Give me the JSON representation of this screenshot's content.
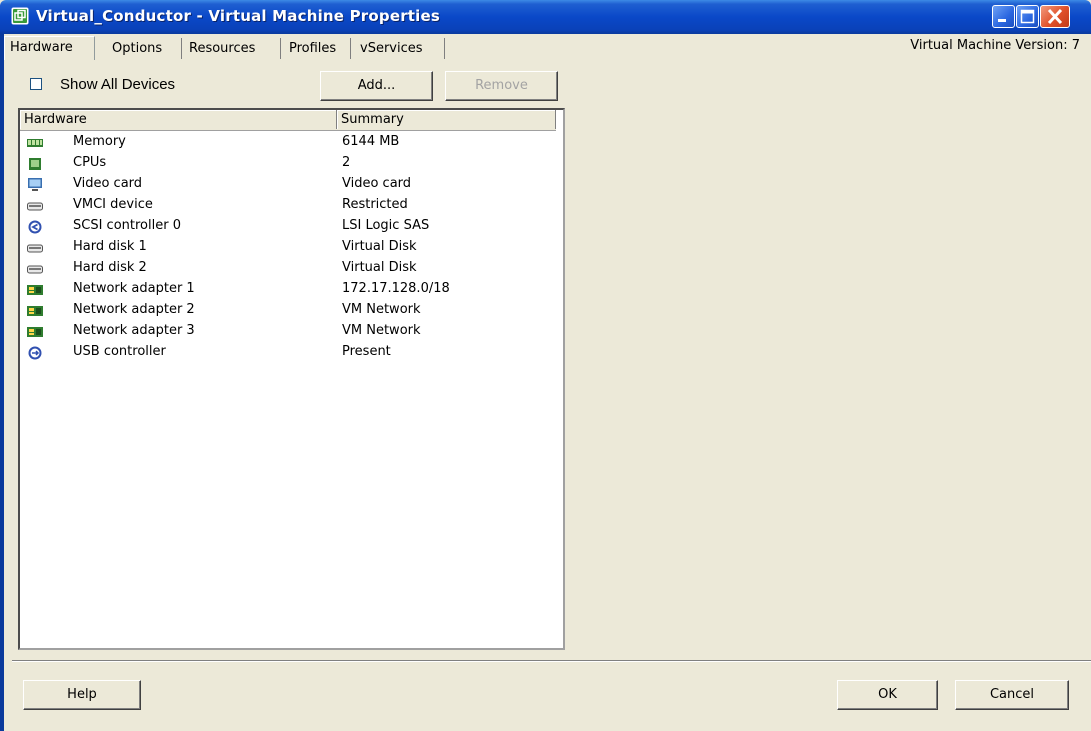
{
  "window": {
    "title": "Virtual_Conductor - Virtual Machine Properties",
    "vm_version": "Virtual Machine Version: 7"
  },
  "tabs": [
    {
      "label": "Hardware",
      "active": true
    },
    {
      "label": "Options"
    },
    {
      "label": "Resources"
    },
    {
      "label": "Profiles"
    },
    {
      "label": "vServices"
    }
  ],
  "toolbar": {
    "show_all_label": "Show All Devices",
    "show_all_checked": false,
    "add_label": "Add...",
    "remove_label": "Remove"
  },
  "table": {
    "columns": [
      "Hardware",
      "Summary"
    ],
    "rows": [
      {
        "icon": "memory-icon",
        "name": "Memory",
        "summary": "6144 MB"
      },
      {
        "icon": "cpu-icon",
        "name": "CPUs",
        "summary": "2"
      },
      {
        "icon": "video-card-icon",
        "name": "Video card",
        "summary": "Video card"
      },
      {
        "icon": "vmci-device-icon",
        "name": "VMCI device",
        "summary": "Restricted"
      },
      {
        "icon": "scsi-controller-icon",
        "name": "SCSI controller 0",
        "summary": "LSI Logic SAS"
      },
      {
        "icon": "hard-disk-icon",
        "name": "Hard disk 1",
        "summary": "Virtual Disk"
      },
      {
        "icon": "hard-disk-icon",
        "name": "Hard disk 2",
        "summary": "Virtual Disk"
      },
      {
        "icon": "network-adapter-icon",
        "name": "Network adapter 1",
        "summary": "172.17.128.0/18"
      },
      {
        "icon": "network-adapter-icon",
        "name": "Network adapter 2",
        "summary": "VM Network"
      },
      {
        "icon": "network-adapter-icon",
        "name": "Network adapter 3",
        "summary": "VM Network"
      },
      {
        "icon": "usb-controller-icon",
        "name": "USB controller",
        "summary": "Present"
      }
    ]
  },
  "footer": {
    "help_label": "Help",
    "ok_label": "OK",
    "cancel_label": "Cancel"
  },
  "colors": {
    "titlebar": "#0a48c8",
    "dialog_bg": "#ece9d8",
    "close_button": "#e0502a"
  }
}
